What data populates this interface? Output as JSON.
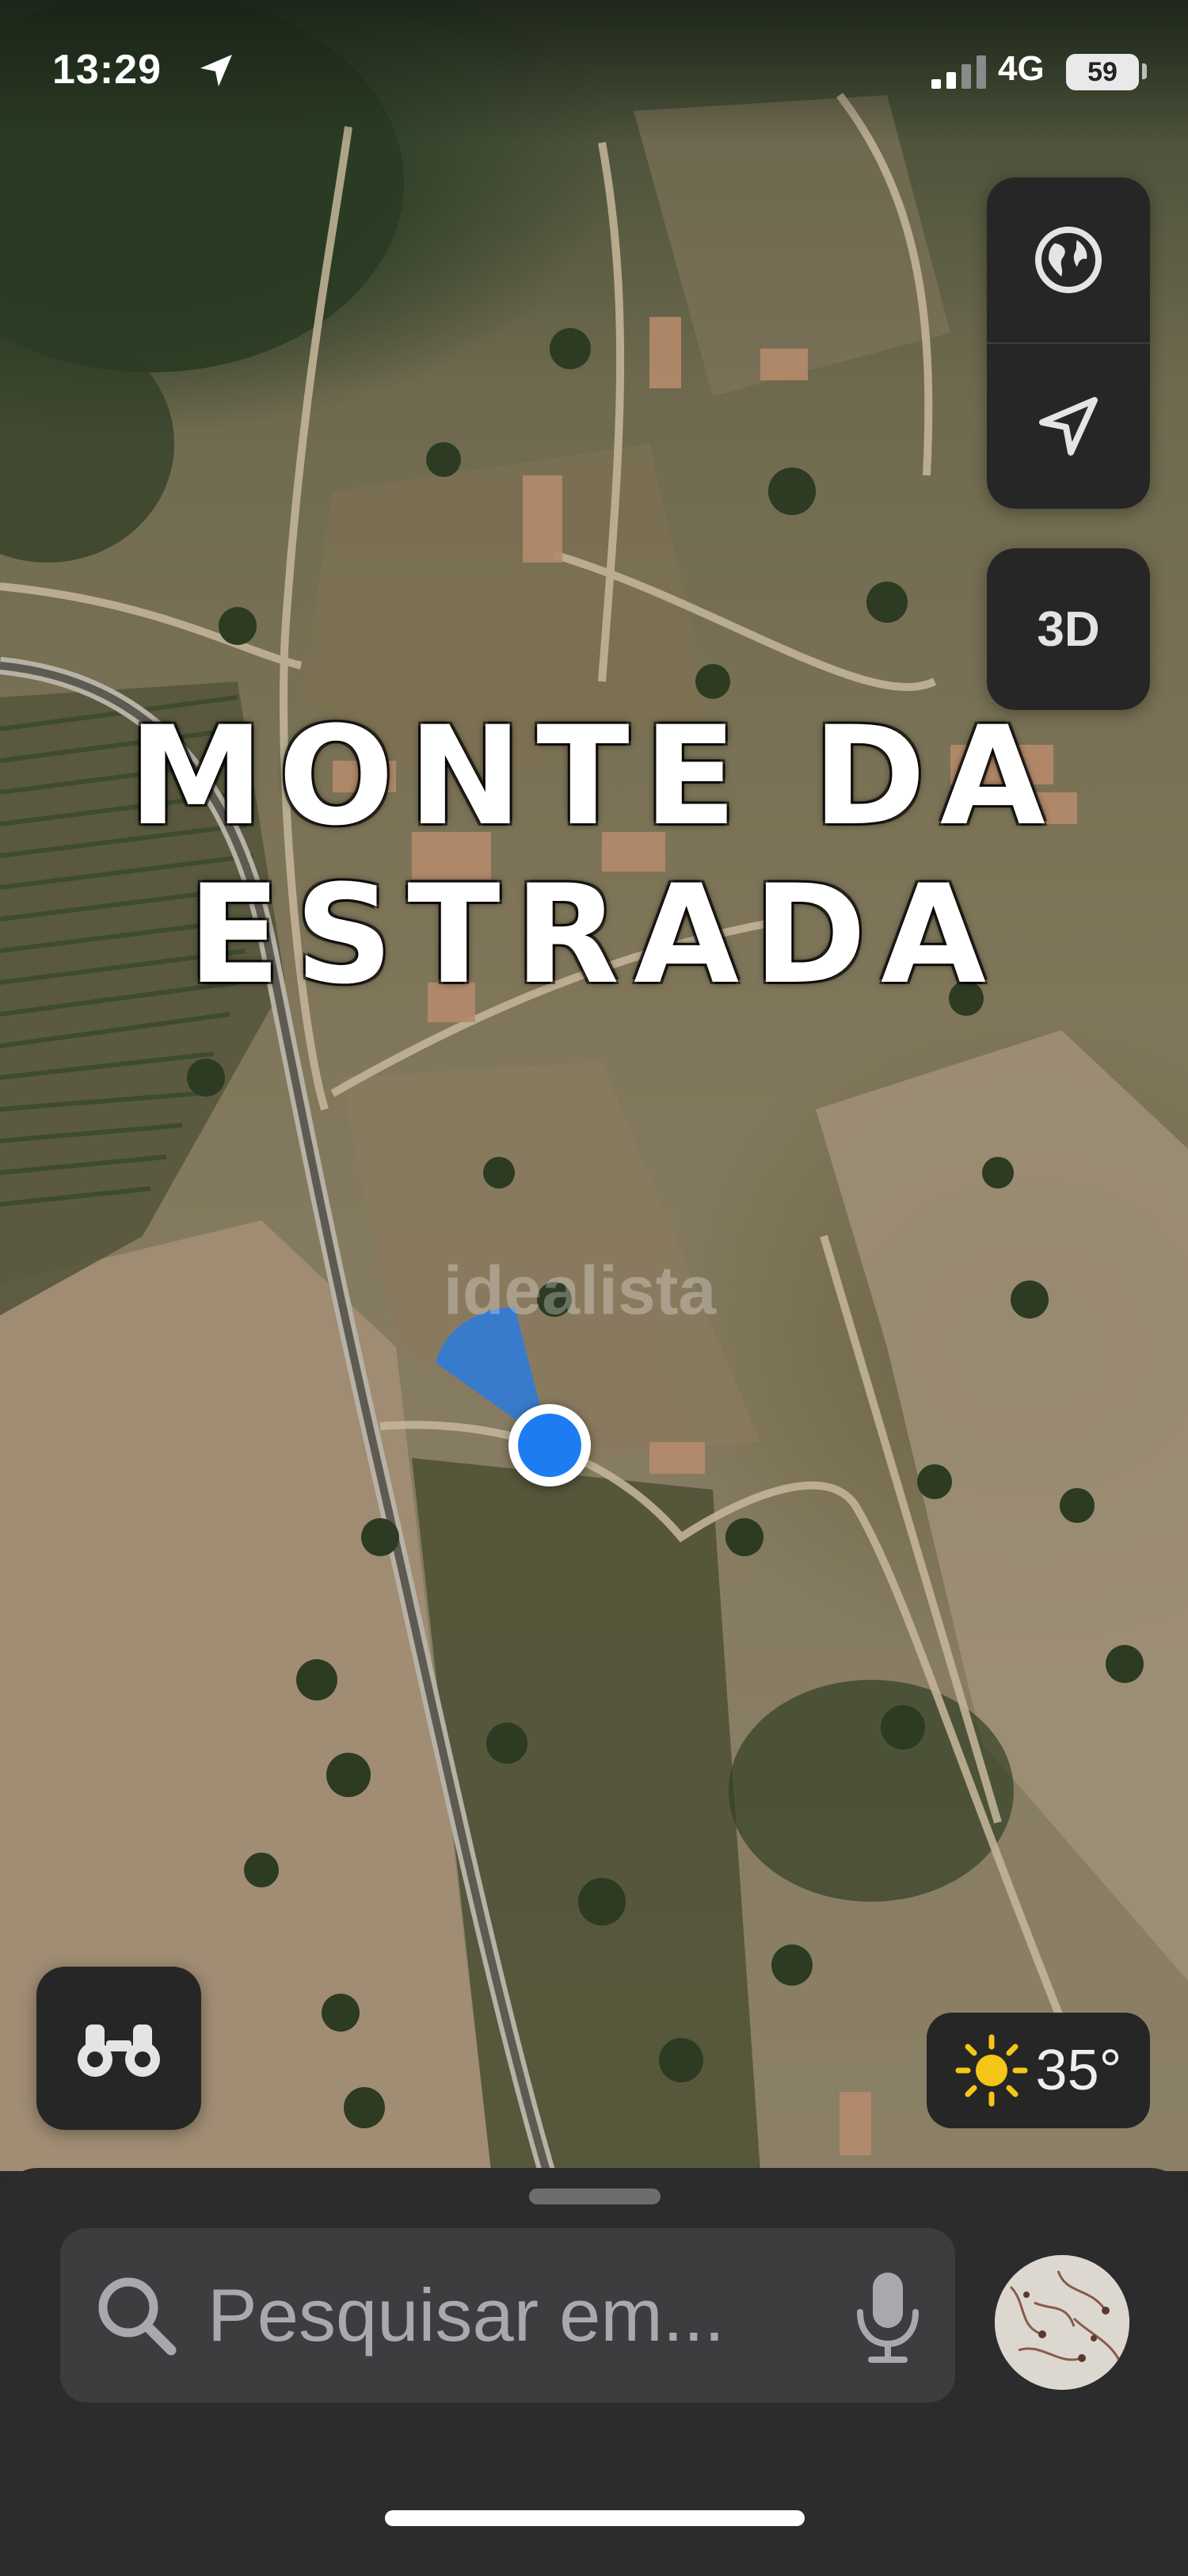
{
  "status": {
    "time": "13:29",
    "network": "4G",
    "battery": "59",
    "location_icon": "location-arrow-icon",
    "signal_icon": "cellular-signal-icon"
  },
  "map": {
    "place_line1": "MONTE DA",
    "place_line2": "ESTRADA",
    "watermark": "idealista"
  },
  "controls": {
    "globe_icon": "globe-icon",
    "locate_icon": "navigation-arrow-icon",
    "view_3d": "3D",
    "binoculars_icon": "binoculars-icon"
  },
  "weather": {
    "icon": "sun-icon",
    "temperature": "35°"
  },
  "search": {
    "placeholder": "Pesquisar em...",
    "search_icon": "magnifying-glass-icon",
    "mic_icon": "microphone-icon"
  },
  "colors": {
    "user_location": "#1e7cf2",
    "sheet_bg": "#2c2c2e",
    "control_bg": "#262626",
    "sun": "#f5c518"
  }
}
